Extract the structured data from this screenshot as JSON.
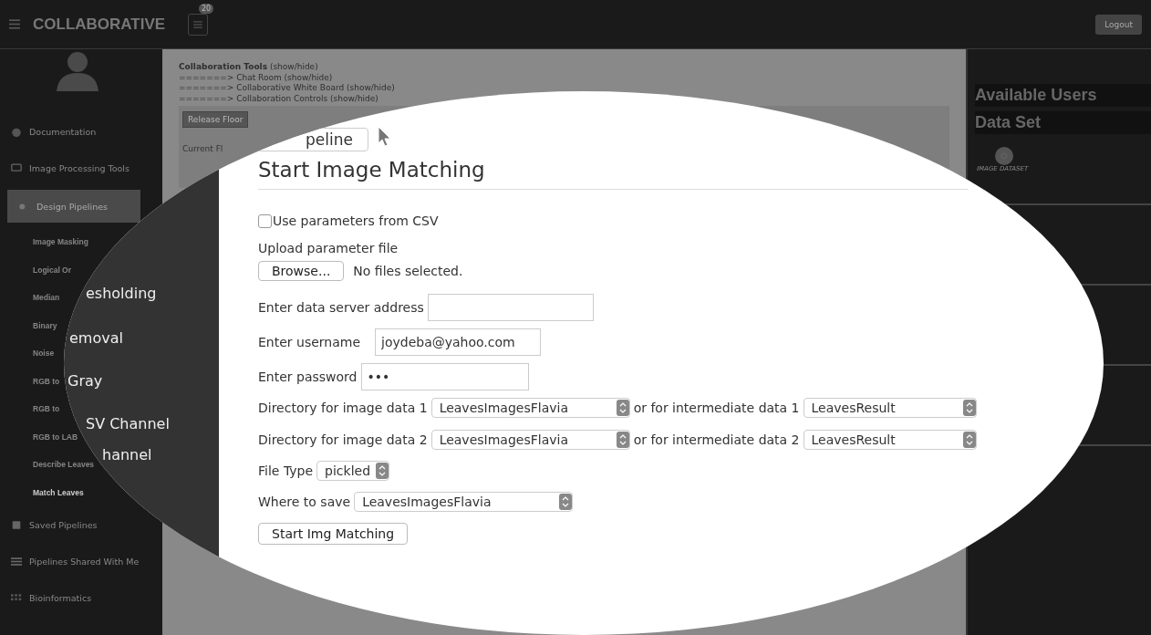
{
  "topbar": {
    "brand": "COLLABORATIVE",
    "notification_count": "20",
    "logout": "Logout"
  },
  "sidebar": {
    "items": [
      {
        "kind": "section",
        "label": "Documentation",
        "selected": false
      },
      {
        "kind": "section",
        "label": "Image Processing Tools",
        "selected": false
      },
      {
        "kind": "section",
        "label": "Design Pipelines",
        "selected": true
      },
      {
        "kind": "subitem",
        "label": "Image Masking",
        "selected": false
      },
      {
        "kind": "subitem",
        "label": "Logical Or",
        "selected": false
      },
      {
        "kind": "subitem",
        "label": "Median",
        "selected": false
      },
      {
        "kind": "subitem",
        "label": "Binary",
        "selected": false
      },
      {
        "kind": "subitem",
        "label": "Noise",
        "selected": false
      },
      {
        "kind": "subitem",
        "label": "RGB to",
        "selected": false
      },
      {
        "kind": "subitem",
        "label": "RGB to",
        "selected": false
      },
      {
        "kind": "subitem",
        "label": "RGB to LAB",
        "selected": false
      },
      {
        "kind": "subitem",
        "label": "Describe Leaves",
        "selected": false
      },
      {
        "kind": "subitem",
        "label": "Match Leaves",
        "selected": true
      },
      {
        "kind": "section",
        "label": "Saved Pipelines",
        "selected": false
      },
      {
        "kind": "section",
        "label": "Pipelines Shared With Me",
        "selected": false
      },
      {
        "kind": "section",
        "label": "Bioinformatics",
        "selected": false
      }
    ]
  },
  "main": {
    "collab_links": [
      "**Collaboration Tools** (show/hide)",
      "=======> Chat Room (show/hide)",
      "=======> Collaborative White Board (show/hide)",
      "=======> Collaboration Controls (show/hide)"
    ],
    "release_floor_button": "Release Floor",
    "current_text": "Current Fl"
  },
  "right_panel": {
    "headings": [
      "Available Users",
      "Data Set"
    ],
    "dataset_label": "IMAGE DATASET"
  },
  "magnifier": {
    "sidebar_fragments": [
      "esholding",
      "emoval",
      "Gray",
      "SV Channel",
      "hannel"
    ],
    "pipeline_button": "peline",
    "form": {
      "title": "Start Image Matching",
      "use_csv": {
        "label": "Use parameters from CSV",
        "checked": false
      },
      "upload_label": "Upload parameter file",
      "browse_button": "Browse...",
      "file_status": "No files selected.",
      "fields": [
        {
          "label": "Enter data server address"
        },
        {
          "label": "Enter username",
          "value": "joydeba@yahoo.com"
        },
        {
          "label": "Enter password",
          "value": "•••"
        }
      ],
      "directory_rows": [
        {
          "label": "Directory for image data 1",
          "value": "LeavesImagesFlavia",
          "or_label": "or for intermediate data 1",
          "or_value": "LeavesResult"
        },
        {
          "label": "Directory for image data 2",
          "value": "LeavesImagesFlavia",
          "or_label": "or for intermediate data 2",
          "or_value": "LeavesResult"
        }
      ],
      "file_type": {
        "label": "File Type",
        "value": "pickled"
      },
      "where_to_save": {
        "label": "Where to save",
        "value": "LeavesImagesFlavia"
      },
      "submit_button": "Start Img Matching"
    }
  }
}
